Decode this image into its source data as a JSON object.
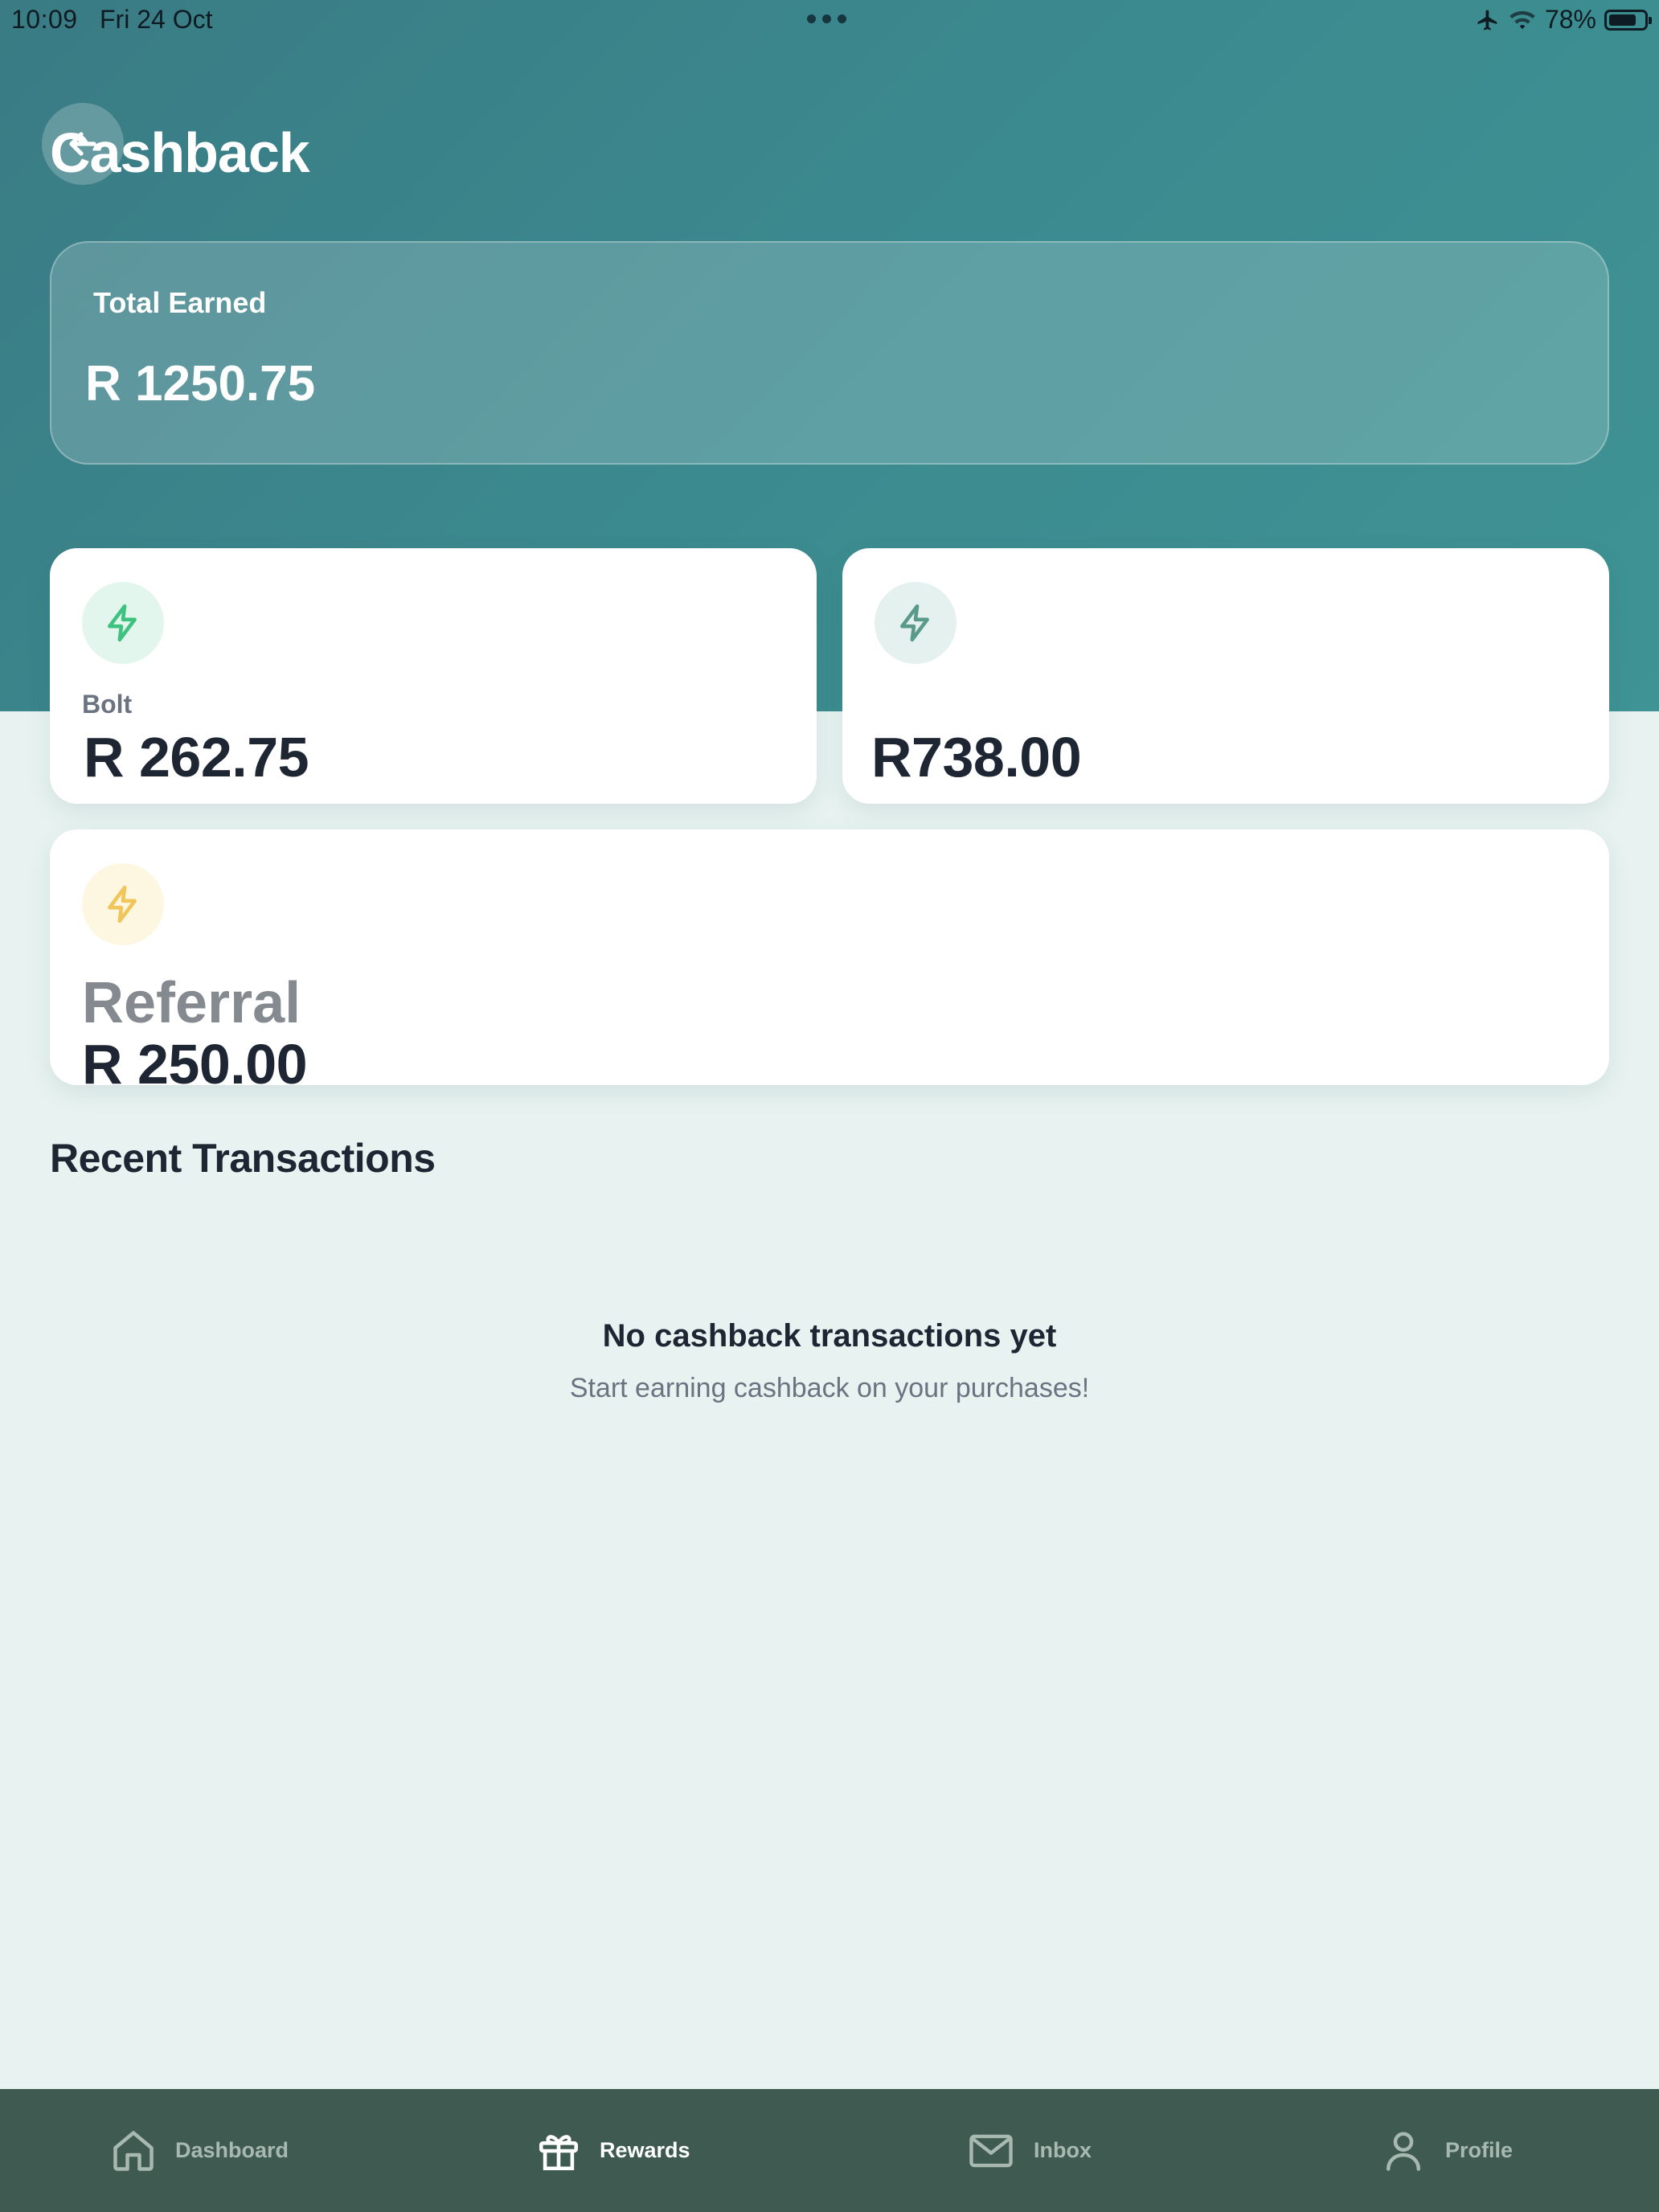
{
  "status_bar": {
    "time": "10:09",
    "date": "Fri 24 Oct",
    "battery_percent": "78%",
    "battery_level": 0.78,
    "icons": [
      "airplane-icon",
      "wifi-icon",
      "battery-icon"
    ]
  },
  "header": {
    "title": "Cashback",
    "back_icon": "arrow-left-icon"
  },
  "total": {
    "label": "Total Earned",
    "value": "R 1250.75"
  },
  "cards": {
    "bolt": {
      "label": "Bolt",
      "value": "R 262.75",
      "icon": "lightning-icon",
      "icon_color": "#3ec27f"
    },
    "other": {
      "label": "",
      "value": "R738.00",
      "icon": "lightning-icon",
      "icon_color": "#5a9a8a"
    },
    "referral": {
      "label": "Referral",
      "value": "R 250.00",
      "icon": "lightning-icon",
      "icon_color": "#f0c55a"
    }
  },
  "transactions": {
    "title": "Recent Transactions",
    "empty_title": "No cashback transactions yet",
    "empty_subtitle": "Start earning cashback on your purchases!"
  },
  "tabs": [
    {
      "label": "Dashboard",
      "icon": "home-icon",
      "active": false
    },
    {
      "label": "Rewards",
      "icon": "gift-icon",
      "active": true
    },
    {
      "label": "Inbox",
      "icon": "mail-icon",
      "active": false
    },
    {
      "label": "Profile",
      "icon": "user-icon",
      "active": false
    }
  ],
  "colors": {
    "header": "#3b8a8f",
    "background": "#e8f3f1",
    "tab_bar": "#3e5a51",
    "text_dark": "#1f2633"
  }
}
